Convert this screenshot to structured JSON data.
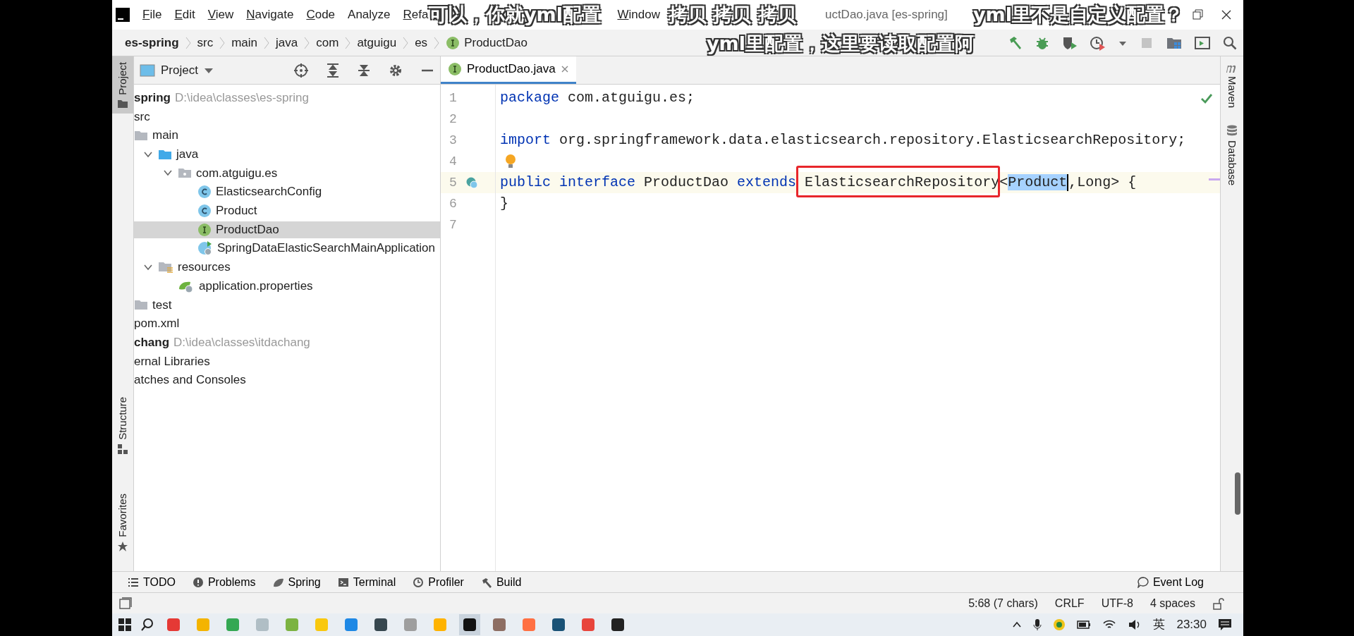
{
  "menu": [
    {
      "label": "File",
      "mnemonic": true
    },
    {
      "label": "Edit",
      "mnemonic": true
    },
    {
      "label": "View",
      "mnemonic": true
    },
    {
      "label": "Navigate",
      "mnemonic": true
    },
    {
      "label": "Code",
      "mnemonic": true
    },
    {
      "label": "Analyze",
      "mnemonic": false
    },
    {
      "label": "Refa",
      "mnemonic": true
    },
    {
      "label": "Window",
      "mnemonic": true
    }
  ],
  "window": {
    "title": "uctDao.java [es-spring]"
  },
  "breadcrumbs": [
    {
      "label": "es-spring",
      "kind": "module"
    },
    {
      "label": "src",
      "kind": "folder"
    },
    {
      "label": "main",
      "kind": "folder"
    },
    {
      "label": "java",
      "kind": "folder"
    },
    {
      "label": "com",
      "kind": "folder"
    },
    {
      "label": "atguigu",
      "kind": "folder"
    },
    {
      "label": "es",
      "kind": "folder"
    },
    {
      "label": "ProductDao",
      "kind": "interface"
    }
  ],
  "left_stripe": [
    {
      "label": "Project",
      "selected": true
    },
    {
      "label": "Structure",
      "selected": false
    },
    {
      "label": "Favorites",
      "selected": false
    }
  ],
  "project_panel": {
    "title": "Project",
    "tree": [
      {
        "label": "spring",
        "path": "D:\\idea\\classes\\es-spring",
        "kind": "module",
        "selected": false,
        "children": [
          {
            "label": "src",
            "selected": false,
            "children": [
              {
                "label": "main",
                "kind": "folder",
                "selected": false,
                "children": [
                  {
                    "label": "java",
                    "kind": "source-folder",
                    "expanded": true,
                    "selected": false,
                    "children": [
                      {
                        "label": "com.atguigu.es",
                        "kind": "package",
                        "expanded": true,
                        "selected": false,
                        "children": [
                          {
                            "label": "ElasticsearchConfig",
                            "kind": "class",
                            "selected": false
                          },
                          {
                            "label": "Product",
                            "kind": "class",
                            "selected": false
                          },
                          {
                            "label": "ProductDao",
                            "kind": "interface",
                            "selected": true
                          },
                          {
                            "label": "SpringDataElasticSearchMainApplication",
                            "kind": "app-class",
                            "selected": false
                          }
                        ]
                      }
                    ]
                  },
                  {
                    "label": "resources",
                    "kind": "resources-folder",
                    "expanded": true,
                    "selected": false,
                    "children": [
                      {
                        "label": "application.properties",
                        "kind": "properties",
                        "selected": false
                      }
                    ]
                  }
                ]
              },
              {
                "label": "test",
                "kind": "folder",
                "selected": false
              }
            ]
          },
          {
            "label": "pom.xml",
            "selected": false
          }
        ]
      },
      {
        "label": "chang",
        "path": "D:\\idea\\classes\\itdachang",
        "kind": "module",
        "selected": false
      },
      {
        "label": "ernal Libraries",
        "selected": false
      },
      {
        "label": "atches and Consoles",
        "selected": false
      }
    ]
  },
  "editor": {
    "tabs": [
      {
        "label": "ProductDao.java",
        "selected": true
      }
    ],
    "lines": [
      {
        "number": "1",
        "current": false,
        "tokens": [
          {
            "text": "package",
            "kind": "keyword"
          },
          {
            "text": " com.atguigu.es;",
            "kind": "plain"
          }
        ]
      },
      {
        "number": "2",
        "current": false
      },
      {
        "number": "3",
        "current": false,
        "tokens": [
          {
            "text": "import",
            "kind": "keyword"
          },
          {
            "text": " org.springframework.data.elasticsearch.repository.ElasticsearchRepository;",
            "kind": "plain"
          }
        ]
      },
      {
        "number": "4",
        "current": false,
        "intention_bulb": true
      },
      {
        "number": "5",
        "current": true,
        "implements_marker": true,
        "tokens": [
          {
            "text": "public",
            "kind": "keyword"
          },
          {
            "text": " interface",
            "kind": "keyword"
          },
          {
            "text": " ProductDao ",
            "kind": "plain"
          },
          {
            "text": "extends",
            "kind": "keyword"
          },
          {
            "text": " ElasticsearchRepository",
            "kind": "plain",
            "annotated": true
          },
          {
            "text": "<",
            "kind": "plain"
          },
          {
            "text": "Product",
            "kind": "selected",
            "caret": true
          },
          {
            "text": ",Long> {",
            "kind": "plain"
          }
        ]
      },
      {
        "number": "6",
        "current": false,
        "tokens": [
          {
            "text": "}",
            "kind": "plain"
          }
        ]
      },
      {
        "number": "7",
        "current": false
      }
    ]
  },
  "right_stripe": [
    {
      "label": "Maven",
      "kind": "maven"
    },
    {
      "label": "Database",
      "kind": "database"
    }
  ],
  "tool_windows": [
    {
      "label": "TODO",
      "kind": "todo"
    },
    {
      "label": "Problems",
      "kind": "problems"
    },
    {
      "label": "Spring",
      "kind": "spring"
    },
    {
      "label": "Terminal",
      "kind": "terminal"
    },
    {
      "label": "Profiler",
      "kind": "profiler"
    },
    {
      "label": "Build",
      "kind": "build"
    }
  ],
  "event_log": "Event Log",
  "status_bar": {
    "position": "5:68 (7 chars)",
    "line_separator": "CRLF",
    "encoding": "UTF-8",
    "indent": "4 spaces"
  },
  "taskbar": {
    "apps": [
      {
        "color": "#e53935",
        "selected": false
      },
      {
        "color": "#f4b400",
        "selected": false
      },
      {
        "color": "#34a853",
        "selected": false
      },
      {
        "color": "#b0bec5",
        "selected": false
      },
      {
        "color": "#7cb342",
        "selected": false
      },
      {
        "color": "#f9c80e",
        "selected": false
      },
      {
        "color": "#1e88e5",
        "selected": false
      },
      {
        "color": "#37474f",
        "selected": false
      },
      {
        "color": "#9e9e9e",
        "selected": false
      },
      {
        "color": "#ffb300",
        "selected": false
      },
      {
        "color": "#111111",
        "selected": true
      },
      {
        "color": "#8d6e63",
        "selected": false
      },
      {
        "color": "#ff7043",
        "selected": false
      },
      {
        "color": "#1a5276",
        "selected": false
      },
      {
        "color": "#e8453c",
        "selected": false
      },
      {
        "color": "#222222",
        "selected": false
      }
    ],
    "ime": "英",
    "time": "23:30"
  },
  "danmaku": [
    "可以，你就yml配置",
    "拷贝  拷贝  拷贝",
    "yml里不是自定义配置？",
    "yml里配置，这里要读取配置阿"
  ]
}
